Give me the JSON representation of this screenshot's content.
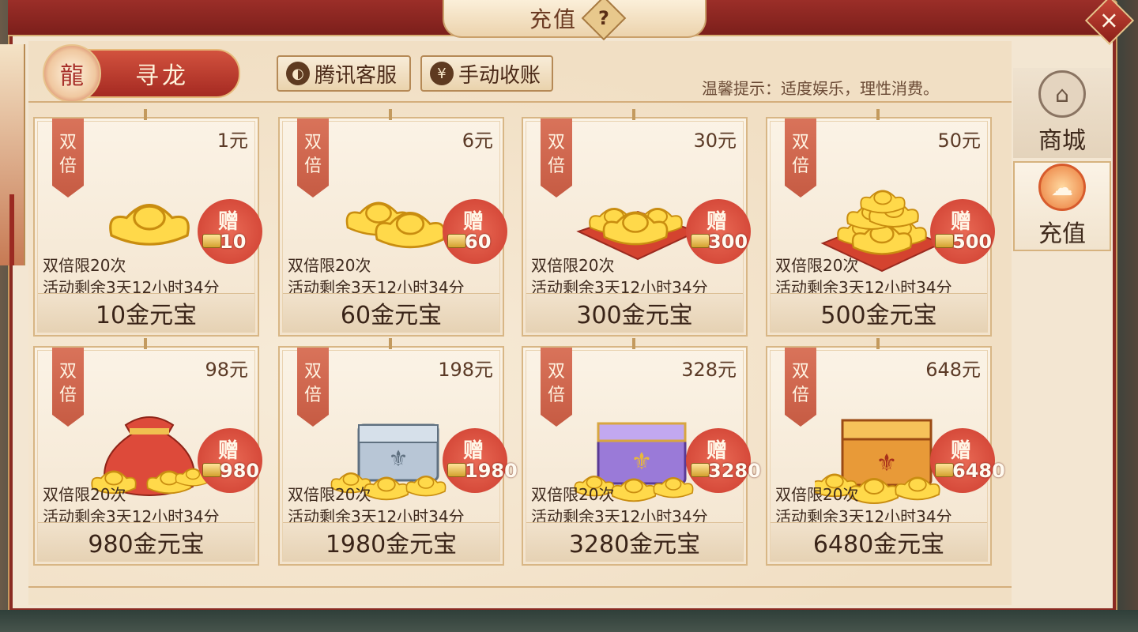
{
  "header": {
    "title": "充值",
    "help_icon": "?",
    "close_icon": "×"
  },
  "dragon_tag": {
    "label": "寻龙"
  },
  "buttons": {
    "tencent_service": "腾讯客服",
    "manual_collect": "手动收账"
  },
  "tip": "温馨提示：适度娱乐，理性消费。",
  "side_tabs": [
    {
      "label": "商城",
      "icon": "palace-icon"
    },
    {
      "label": "充值",
      "icon": "recharge-icon"
    }
  ],
  "cards": [
    {
      "double": "双倍",
      "price": "1元",
      "bonus_label": "赠",
      "bonus_amount": "10",
      "limit": "双倍限20次",
      "remain": "活动剩余3天12小时34分",
      "gold": "10金元宝",
      "art": "single-ingot"
    },
    {
      "double": "双倍",
      "price": "6元",
      "bonus_label": "赠",
      "bonus_amount": "60",
      "limit": "双倍限20次",
      "remain": "活动剩余3天12小时34分",
      "gold": "60金元宝",
      "art": "two-ingots"
    },
    {
      "double": "双倍",
      "price": "30元",
      "bonus_label": "赠",
      "bonus_amount": "300",
      "limit": "双倍限20次",
      "remain": "活动剩余3天12小时34分",
      "gold": "300金元宝",
      "art": "ingots-on-cloth"
    },
    {
      "double": "双倍",
      "price": "50元",
      "bonus_label": "赠",
      "bonus_amount": "500",
      "limit": "双倍限20次",
      "remain": "活动剩余3天12小时34分",
      "gold": "500金元宝",
      "art": "ingot-pile"
    },
    {
      "double": "双倍",
      "price": "98元",
      "bonus_label": "赠",
      "bonus_amount": "980",
      "limit": "双倍限20次",
      "remain": "活动剩余3天12小时34分",
      "gold": "980金元宝",
      "art": "money-bag"
    },
    {
      "double": "双倍",
      "price": "198元",
      "bonus_label": "赠",
      "bonus_amount": "1980",
      "limit": "双倍限20次",
      "remain": "活动剩余3天12小时34分",
      "gold": "1980金元宝",
      "art": "silver-chest"
    },
    {
      "double": "双倍",
      "price": "328元",
      "bonus_label": "赠",
      "bonus_amount": "3280",
      "limit": "双倍限20次",
      "remain": "活动剩余3天12小时34分",
      "gold": "3280金元宝",
      "art": "purple-chest"
    },
    {
      "double": "双倍",
      "price": "648元",
      "bonus_label": "赠",
      "bonus_amount": "6480",
      "limit": "双倍限20次",
      "remain": "活动剩余3天12小时34分",
      "gold": "6480金元宝",
      "art": "gold-chest"
    }
  ],
  "colors": {
    "frame_red": "#8a2a22",
    "ribbon": "#d9735a",
    "bonus_badge": "#d64a3a",
    "gold": "#e8b83a",
    "text_dark": "#3e2a1e"
  }
}
